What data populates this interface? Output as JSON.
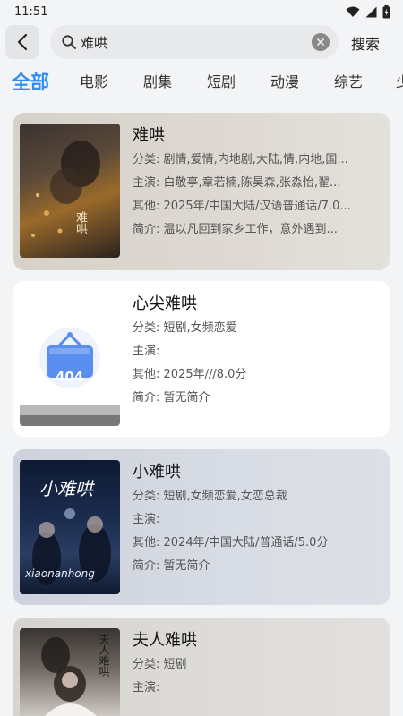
{
  "status": {
    "time": "11:51"
  },
  "search": {
    "query": "难哄",
    "button_label": "搜索"
  },
  "tabs": [
    {
      "label": "全部",
      "active": true
    },
    {
      "label": "电影"
    },
    {
      "label": "剧集"
    },
    {
      "label": "短剧"
    },
    {
      "label": "动漫"
    },
    {
      "label": "综艺"
    },
    {
      "label": "少"
    }
  ],
  "labels": {
    "category": "分类:",
    "cast": "主演:",
    "other": "其他:",
    "intro": "简介:"
  },
  "results": [
    {
      "title": "难哄",
      "category": "剧情,爱情,内地剧,大陆,情,内地,国...",
      "cast": "白敬亭,章若楠,陈昊森,张淼怡,翟...",
      "other": "2025年/中国大陆/汉语普通话/7.0...",
      "intro": "温以凡回到家乡工作，意外遇到...",
      "poster_text": "难哄"
    },
    {
      "title": "心尖难哄",
      "category": "短剧,女频恋爱",
      "cast": "",
      "other": "2025年///8.0分",
      "intro": "暂无简介",
      "poster_text": "404"
    },
    {
      "title": "小难哄",
      "category": "短剧,女频恋爱,女恋总裁",
      "cast": "",
      "other": "2024年/中国大陆/普通话/5.0分",
      "intro": "暂无简介",
      "poster_text": "小难哄",
      "poster_sub": "xiaonanhong"
    },
    {
      "title": "夫人难哄",
      "category": "短剧",
      "cast": "",
      "poster_text": "夫人难哄"
    }
  ]
}
